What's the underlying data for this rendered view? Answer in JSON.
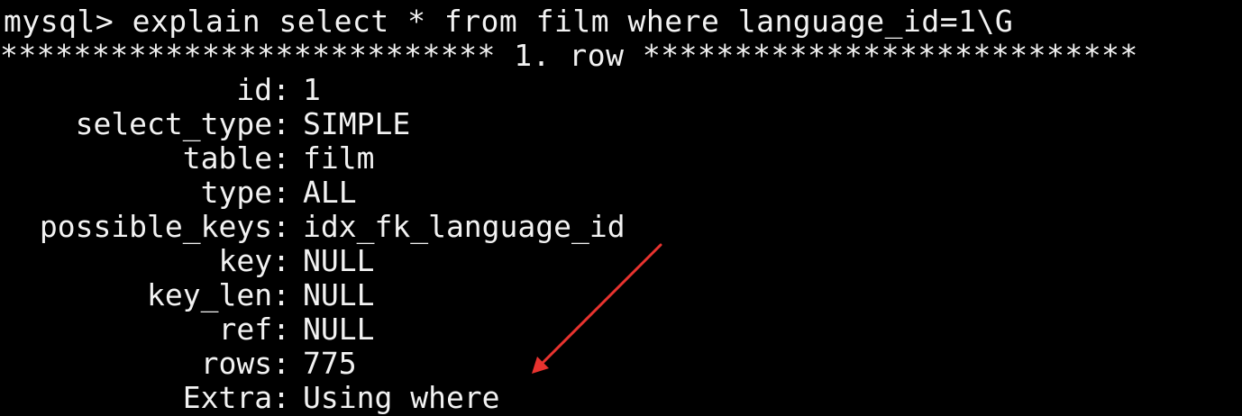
{
  "terminal": {
    "command_line": "mysql> explain select * from film where language_id=1\\G",
    "row_header": "*************************** 1. row ***************************",
    "fields": [
      {
        "label": "id:",
        "value": "1"
      },
      {
        "label": "select_type:",
        "value": "SIMPLE"
      },
      {
        "label": "table:",
        "value": "film"
      },
      {
        "label": "type:",
        "value": "ALL"
      },
      {
        "label": "possible_keys:",
        "value": "idx_fk_language_id"
      },
      {
        "label": "key:",
        "value": "NULL"
      },
      {
        "label": "key_len:",
        "value": "NULL"
      },
      {
        "label": "ref:",
        "value": "NULL"
      },
      {
        "label": "rows:",
        "value": "775"
      },
      {
        "label": "Extra:",
        "value": "Using where"
      }
    ]
  },
  "annotation": {
    "arrow_color": "#e8332f"
  }
}
